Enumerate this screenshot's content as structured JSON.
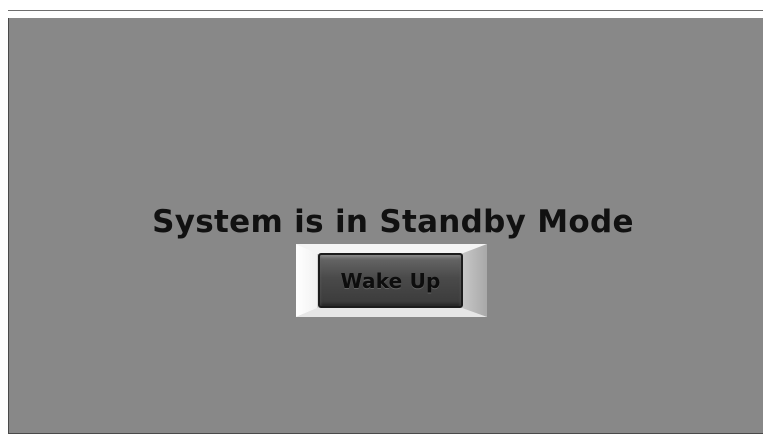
{
  "standby": {
    "message": "System is in Standby Mode",
    "wake_button_label": "Wake Up"
  },
  "colors": {
    "panel_background": "#888888",
    "text": "#111111",
    "button_face": "#4a4a4a",
    "bevel_light": "#ffffff",
    "bevel_dark": "#a8a8a8"
  }
}
